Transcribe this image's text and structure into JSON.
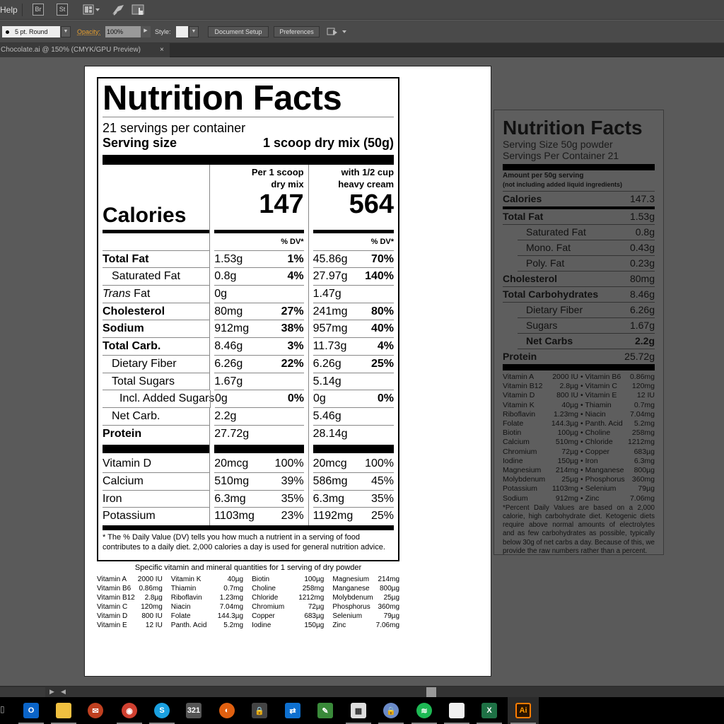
{
  "menubar": {
    "help_label": "Help",
    "icons": [
      "bridge-icon",
      "stock-icon",
      "workspace-layout-icon",
      "gpu-performance-icon",
      "touch-workspace-icon"
    ],
    "bridge_label": "Br",
    "stock_label": "St"
  },
  "control_bar": {
    "brush": "5 pt. Round",
    "opacity_label": "Opacity:",
    "opacity_value": "100%",
    "style_label": "Style:",
    "document_setup": "Document Setup",
    "preferences": "Preferences"
  },
  "document_tab": {
    "title": "Chocolate.ai @ 150% (CMYK/GPU Preview)",
    "close": "×"
  },
  "label": {
    "title": "Nutrition Facts",
    "servings": "21 servings per container",
    "serving_size_label": "Serving size",
    "serving_size_value": "1 scoop dry mix (50g)",
    "calories_label": "Calories",
    "col1_header_line1": "Per 1 scoop",
    "col1_header_line2": "dry mix",
    "col2_header_line1": "with 1/2 cup",
    "col2_header_line2": "heavy cream",
    "col1_calories": "147",
    "col2_calories": "564",
    "dv_header": "% DV*",
    "nutrients": [
      {
        "name": "Total Fat",
        "a1": "1.53g",
        "p1": "1%",
        "a2": "45.86g",
        "p2": "70%"
      },
      {
        "name": "Saturated Fat",
        "a1": "0.8g",
        "p1": "4%",
        "a2": "27.97g",
        "p2": "140%"
      },
      {
        "name_italic": "Trans",
        "name": " Fat",
        "a1": "0g",
        "p1": "",
        "a2": "1.47g",
        "p2": ""
      },
      {
        "name": "Cholesterol",
        "a1": "80mg",
        "p1": "27%",
        "a2": "241mg",
        "p2": "80%"
      },
      {
        "name": "Sodium",
        "a1": "912mg",
        "p1": "38%",
        "a2": "957mg",
        "p2": "40%"
      },
      {
        "name": "Total Carb.",
        "a1": "8.46g",
        "p1": "3%",
        "a2": "11.73g",
        "p2": "4%"
      },
      {
        "name": "Dietary Fiber",
        "a1": "6.26g",
        "p1": "22%",
        "a2": "6.26g",
        "p2": "25%"
      },
      {
        "name": "Total Sugars",
        "a1": "1.67g",
        "p1": "",
        "a2": "5.14g",
        "p2": ""
      },
      {
        "name": "Incl. Added Sugars",
        "a1": "0g",
        "p1": "0%",
        "a2": "0g",
        "p2": "0%"
      },
      {
        "name": "Net Carb.",
        "a1": "2.2g",
        "p1": "",
        "a2": "5.46g",
        "p2": ""
      },
      {
        "name": "Protein",
        "a1": "27.72g",
        "p1": "",
        "a2": "28.14g",
        "p2": ""
      }
    ],
    "minerals": [
      {
        "name": "Vitamin D",
        "a1": "20mcg",
        "p1": "100%",
        "a2": "20mcg",
        "p2": "100%"
      },
      {
        "name": "Calcium",
        "a1": "510mg",
        "p1": "39%",
        "a2": "586mg",
        "p2": "45%"
      },
      {
        "name": "Iron",
        "a1": "6.3mg",
        "p1": "35%",
        "a2": "6.3mg",
        "p2": "35%"
      },
      {
        "name": "Potassium",
        "a1": "1103mg",
        "p1": "23%",
        "a2": "1192mg",
        "p2": "25%"
      }
    ],
    "footnote": "* The % Daily Value (DV) tells you how much a nutrient in a serving of food contributes to a daily diet. 2,000 calories a day is used for general nutrition advice."
  },
  "specific": {
    "title": "Specific vitamin and mineral quantities for 1 serving of dry powder",
    "columns": [
      [
        [
          "Vitamin A",
          "2000 IU"
        ],
        [
          "Vitamin B6",
          "0.86mg"
        ],
        [
          "Vitamin B12",
          "2.8µg"
        ],
        [
          "Vitamin C",
          "120mg"
        ],
        [
          "Vitamin D",
          "800 IU"
        ],
        [
          "Vitamin E",
          "12 IU"
        ]
      ],
      [
        [
          "Vitamin K",
          "40µg"
        ],
        [
          "Thiamin",
          "0.7mg"
        ],
        [
          "Riboflavin",
          "1.23mg"
        ],
        [
          "Niacin",
          "7.04mg"
        ],
        [
          "Folate",
          "144.3µg"
        ],
        [
          "Panth. Acid",
          "5.2mg"
        ]
      ],
      [
        [
          "Biotin",
          "100µg"
        ],
        [
          "Choline",
          "258mg"
        ],
        [
          "Chloride",
          "1212mg"
        ],
        [
          "Chromium",
          "72µg"
        ],
        [
          "Copper",
          "683µg"
        ],
        [
          "Iodine",
          "150µg"
        ]
      ],
      [
        [
          "Magnesium",
          "214mg"
        ],
        [
          "Manganese",
          "800µg"
        ],
        [
          "Molybdenum",
          "25µg"
        ],
        [
          "Phosphorus",
          "360mg"
        ],
        [
          "Selenium",
          "79µg"
        ],
        [
          "Zinc",
          "7.06mg"
        ]
      ]
    ]
  },
  "label2": {
    "title": "Nutrition Facts",
    "serving_size": "Serving Size 50g powder",
    "servings": "Servings Per Container 21",
    "amount_line1": "Amount per 50g serving",
    "amount_line2": "(not including added liquid ingredients)",
    "calories_label": "Calories",
    "calories_value": "147.3",
    "rows": [
      {
        "name": "Total Fat",
        "value": "1.53g",
        "bold": true,
        "indent": false
      },
      {
        "name": "Saturated Fat",
        "value": "0.8g",
        "bold": false,
        "indent": true
      },
      {
        "name": "Mono. Fat",
        "value": "0.43g",
        "bold": false,
        "indent": true
      },
      {
        "name": "Poly. Fat",
        "value": "0.23g",
        "bold": false,
        "indent": true
      },
      {
        "name": "Cholesterol",
        "value": "80mg",
        "bold": true,
        "indent": false
      },
      {
        "name": "Total Carbohydrates",
        "value": "8.46g",
        "bold": true,
        "indent": false
      },
      {
        "name": "Dietary Fiber",
        "value": "6.26g",
        "bold": false,
        "indent": true
      },
      {
        "name": "Sugars",
        "value": "1.67g",
        "bold": false,
        "indent": true
      },
      {
        "name": "Net Carbs",
        "value": "2.2g",
        "bold": true,
        "indent": true
      },
      {
        "name": "Protein",
        "value": "25.72g",
        "bold": true,
        "indent": false
      }
    ],
    "vitamins": [
      [
        "Vitamin A",
        "2000 IU",
        "Vitamin B6",
        "0.86mg"
      ],
      [
        "Vitamin B12",
        "2.8µg",
        "Vitamin C",
        "120mg"
      ],
      [
        "Vitamin D",
        "800 IU",
        "Vitamin E",
        "12 IU"
      ],
      [
        "Vitamin K",
        "40µg",
        "Thiamin",
        "0.7mg"
      ],
      [
        "Riboflavin",
        "1.23mg",
        "Niacin",
        "7.04mg"
      ],
      [
        "Folate",
        "144.3µg",
        "Panth. Acid",
        "5.2mg"
      ],
      [
        "Biotin",
        "100µg",
        "Choline",
        "258mg"
      ],
      [
        "Calcium",
        "510mg",
        "Chloride",
        "1212mg"
      ],
      [
        "Chromium",
        "72µg",
        "Copper",
        "683µg"
      ],
      [
        "Iodine",
        "150µg",
        "Iron",
        "6.3mg"
      ],
      [
        "Magnesium",
        "214mg",
        "Manganese",
        "800µg"
      ],
      [
        "Molybdenum",
        "25µg",
        "Phosphorus",
        "360mg"
      ],
      [
        "Potassium",
        "1103mg",
        "Selenium",
        "79µg"
      ],
      [
        "Sodium",
        "912mg",
        "Zinc",
        "7.06mg"
      ]
    ],
    "note": "*Percent Daily Values are based on a 2,000 calorie, high carbohydrate diet. Ketogenic diets require above normal amounts of electrolytes and as few carbohydrates as possible, typically below 30g of net carbs a day. Because of this, we provide the raw numbers rather than a percent."
  },
  "taskbar": {
    "items": [
      {
        "name": "outlook",
        "glyph": "O",
        "color": "#0a64c8"
      },
      {
        "name": "file-explorer",
        "glyph": "",
        "color": "#f0c040"
      },
      {
        "name": "thunderbird",
        "glyph": "✉",
        "color": "#c04020"
      },
      {
        "name": "chrome",
        "glyph": "◉",
        "color": "#d04030"
      },
      {
        "name": "skype",
        "glyph": "S",
        "color": "#1aa0e0"
      },
      {
        "name": "media-player",
        "glyph": "321",
        "color": "#555"
      },
      {
        "name": "firefox",
        "glyph": "◐",
        "color": "#e06010"
      },
      {
        "name": "vpn",
        "glyph": "🔒",
        "color": "#444"
      },
      {
        "name": "teamviewer",
        "glyph": "⇄",
        "color": "#0e70d0"
      },
      {
        "name": "notepad-green",
        "glyph": "✎",
        "color": "#3a8a3a"
      },
      {
        "name": "calculator",
        "glyph": "▦",
        "color": "#ddd"
      },
      {
        "name": "keepass",
        "glyph": "🔒",
        "color": "#6a8ac8"
      },
      {
        "name": "spotify",
        "glyph": "≋",
        "color": "#1db954"
      },
      {
        "name": "document",
        "glyph": "",
        "color": "#f0f0f0"
      },
      {
        "name": "excel",
        "glyph": "X",
        "color": "#1e7145"
      },
      {
        "name": "illustrator",
        "glyph": "Ai",
        "color": "#2a1400"
      }
    ]
  }
}
